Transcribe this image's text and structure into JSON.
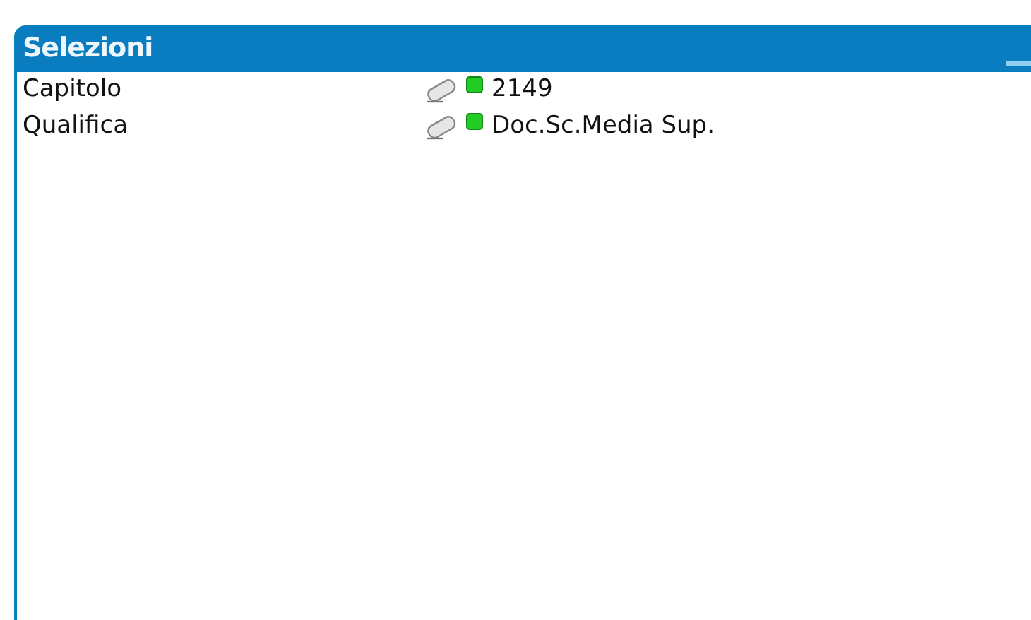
{
  "panel": {
    "title": "Selezioni"
  },
  "rows": [
    {
      "label": "Capitolo",
      "value": "2149"
    },
    {
      "label": "Qualifica",
      "value": "Doc.Sc.Media Sup."
    }
  ]
}
